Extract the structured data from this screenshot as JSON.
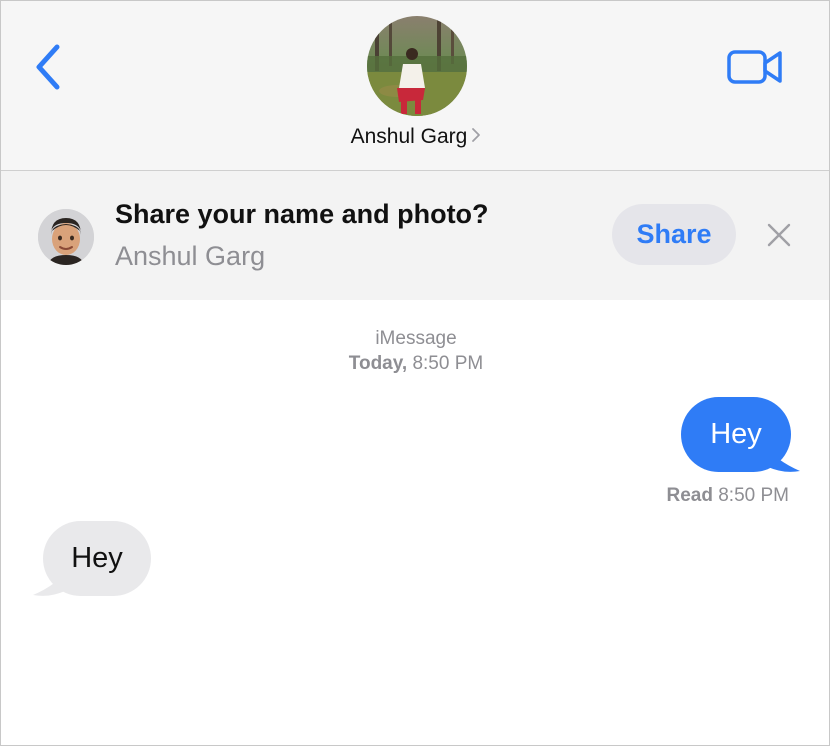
{
  "header": {
    "contact_name": "Anshul Garg",
    "icons": {
      "back": "chevron-left-icon",
      "video": "video-camera-icon",
      "name_chevron": "chevron-right-icon"
    }
  },
  "banner": {
    "title": "Share your name and photo?",
    "subtitle": "Anshul Garg",
    "share_label": "Share",
    "icons": {
      "close": "close-icon",
      "memoji": "memoji-avatar"
    }
  },
  "conversation": {
    "service": "iMessage",
    "date_bold": "Today,",
    "time": " 8:50 PM",
    "messages": [
      {
        "direction": "sent",
        "text": "Hey"
      },
      {
        "direction": "received",
        "text": "Hey"
      }
    ],
    "read_label": "Read",
    "read_time": " 8:50 PM"
  },
  "colors": {
    "accent_blue": "#2f7cf6",
    "sent_bubble": "#2f7cf6",
    "received_bubble": "#e9e9eb",
    "secondary_text": "#8e8e93",
    "header_bg": "#f6f6f6"
  }
}
